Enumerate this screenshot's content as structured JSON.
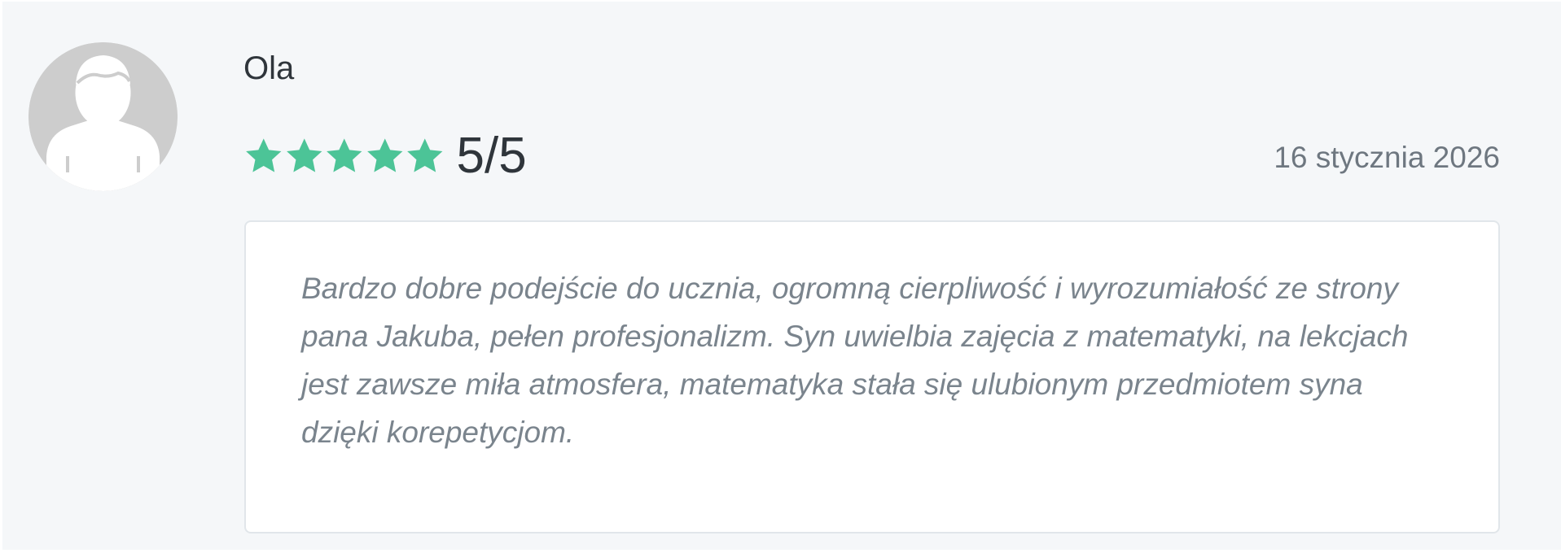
{
  "review": {
    "author": "Ola",
    "avatar_icon": "user-silhouette-icon",
    "rating": {
      "stars": 5,
      "max": 5,
      "label": "5/5",
      "star_icon": "star-icon",
      "star_color": "#4cc497"
    },
    "date": "16 stycznia 2026",
    "text": "Bardzo dobre podejście do ucznia, ogromną cierpliwość i wyrozumiałość ze strony pana Jakuba, pełen profesjonalizm. Syn uwielbia zajęcia z matematyki, na lekcjach jest zawsze miła atmosfera, matematyka stała się ulubionym przedmiotem syna dzięki korepetycjom."
  },
  "colors": {
    "card_background": "#f5f7f9",
    "avatar_background": "#cdcdcd",
    "name_text": "#2f353b",
    "date_text": "#6e7780",
    "review_text": "#7a848d"
  }
}
